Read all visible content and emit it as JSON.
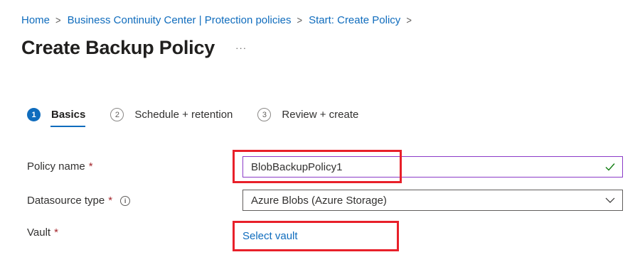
{
  "breadcrumb": {
    "items": [
      "Home",
      "Business Continuity Center | Protection policies",
      "Start: Create Policy"
    ],
    "separator": ">"
  },
  "page": {
    "title": "Create Backup Policy",
    "more": "···"
  },
  "tabs": [
    {
      "number": "1",
      "label": "Basics",
      "active": true
    },
    {
      "number": "2",
      "label": "Schedule + retention",
      "active": false
    },
    {
      "number": "3",
      "label": "Review + create",
      "active": false
    }
  ],
  "form": {
    "policy_name": {
      "label": "Policy name",
      "required_mark": "*",
      "value": "BlobBackupPolicy1"
    },
    "datasource_type": {
      "label": "Datasource type",
      "required_mark": "*",
      "info": "i",
      "value": "Azure Blobs (Azure Storage)"
    },
    "vault": {
      "label": "Vault",
      "required_mark": "*",
      "link": "Select vault"
    }
  },
  "colors": {
    "link": "#0f6cbd",
    "accent": "#0f6cbd",
    "focus_border": "#8b3bc7",
    "valid_check": "#107c10",
    "highlight": "#e8202a",
    "required": "#a4262c"
  },
  "icons": {
    "more": "more-horizontal-icon",
    "info": "info-icon",
    "check": "checkmark-icon",
    "chevron": "chevron-down-icon",
    "separator": "chevron-right-icon"
  }
}
